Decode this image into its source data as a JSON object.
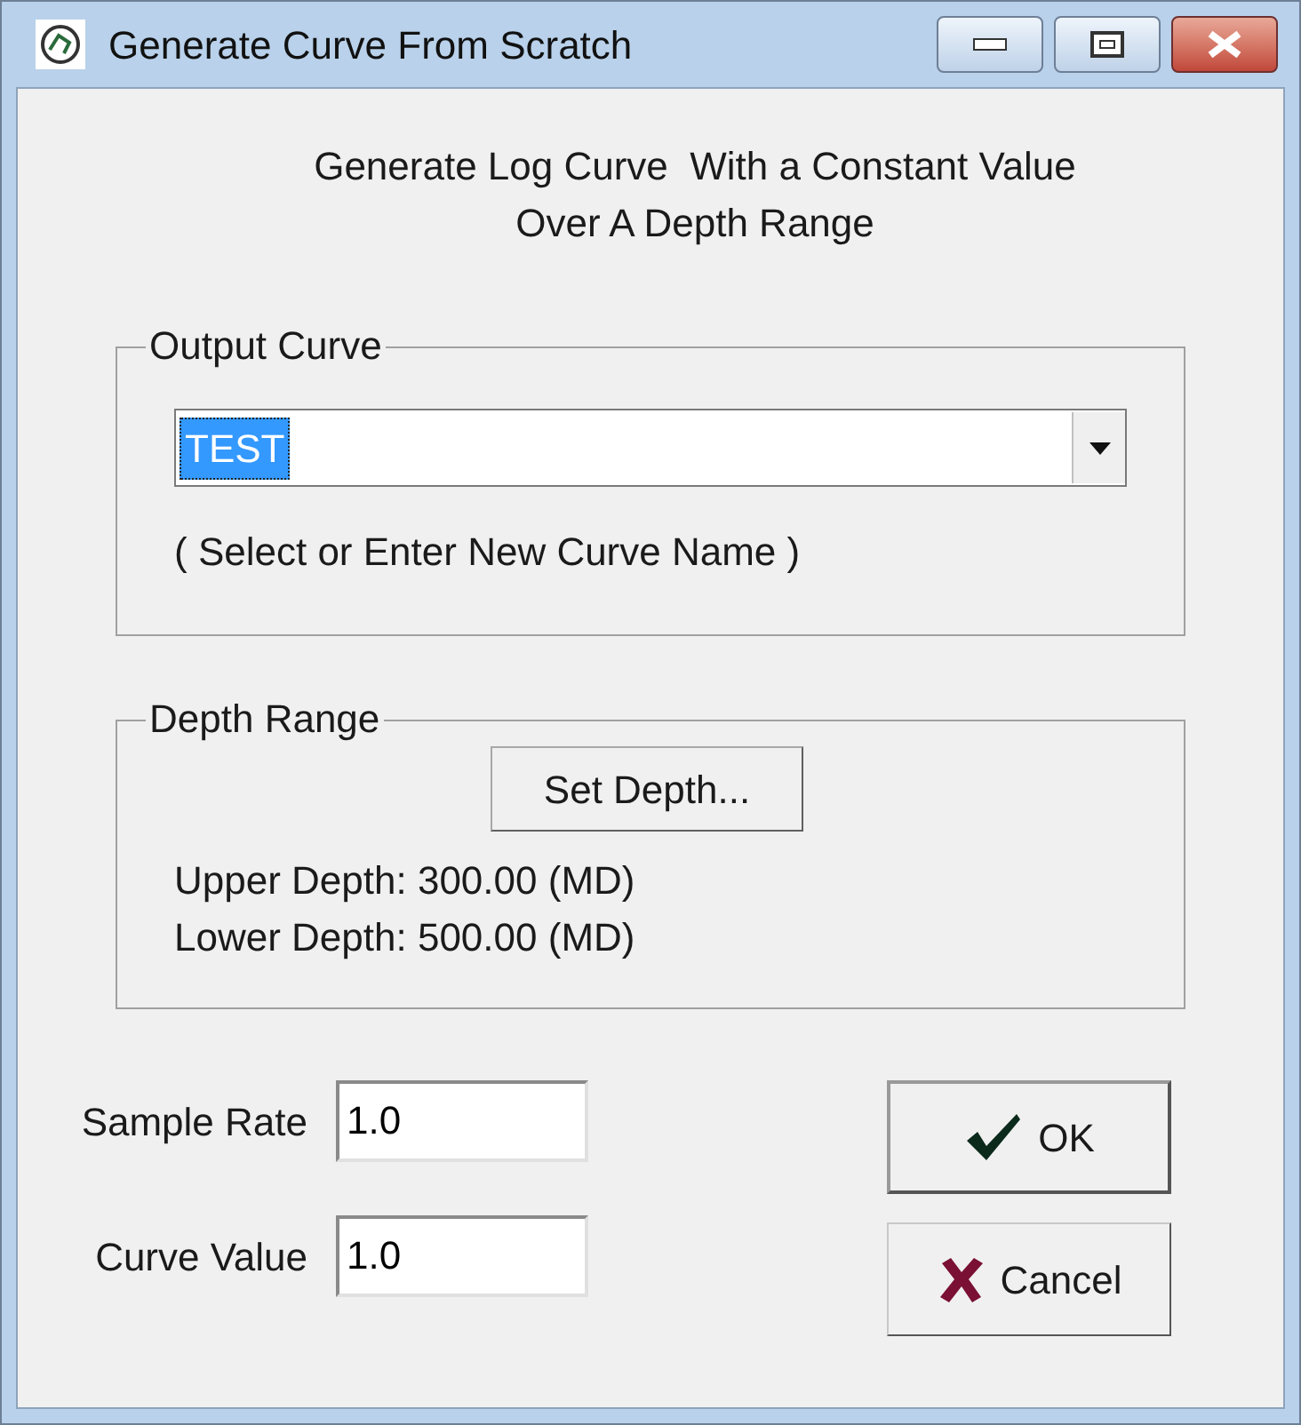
{
  "window": {
    "title": "Generate Curve From Scratch"
  },
  "intro": [
    "Generate Log Curve  With a Constant Value",
    "Over A Depth Range"
  ],
  "output_curve": {
    "legend": "Output Curve",
    "value": "TEST",
    "text_selected": true,
    "hint": "( Select or Enter New Curve Name )"
  },
  "depth_range": {
    "legend": "Depth Range",
    "button": "Set Depth...",
    "upper": "Upper Depth: 300.00 (MD)",
    "lower": "Lower Depth: 500.00 (MD)"
  },
  "fields": [
    {
      "label": "Sample Rate",
      "value": "1.0"
    },
    {
      "label": "Curve Value",
      "value": "1.0"
    }
  ],
  "buttons": [
    {
      "kind": "ok",
      "label": "OK",
      "default": true
    },
    {
      "kind": "cancel",
      "label": "Cancel",
      "default": false
    }
  ]
}
